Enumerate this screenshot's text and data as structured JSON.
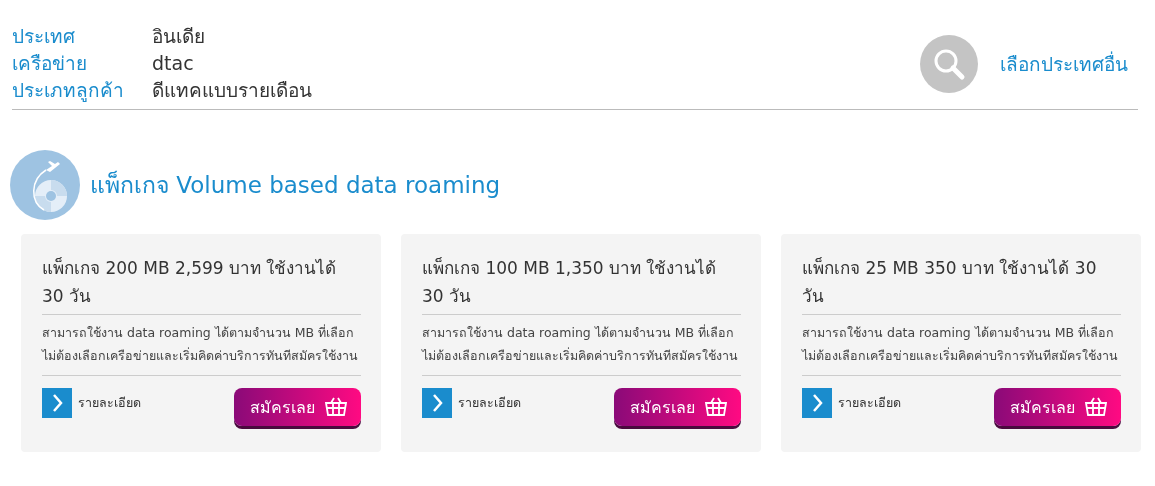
{
  "info": [
    {
      "label": "ประเทศ",
      "value": "อินเดีย"
    },
    {
      "label": "เครือข่าย",
      "value": "dtac"
    },
    {
      "label": "ประเภทลูกค้า",
      "value": "ดีแทคแบบรายเดือน"
    }
  ],
  "change_country": "เลือกประเทศอื่น",
  "section_title": "แพ็กเกจ Volume based data roaming",
  "packages": [
    {
      "title": "แพ็กเกจ 200 MB 2,599 บาท ใช้งานได้ 30 วัน",
      "description": "สามารถใช้งาน data roaming ได้ตามจำนวน MB ที่เลือก ไม่ต้องเลือกเครือข่ายและเริ่มคิดค่าบริการทันทีสมัครใช้งาน",
      "details": "รายละเอียด",
      "subscribe": "สมัครเลย"
    },
    {
      "title": "แพ็กเกจ 100 MB 1,350 บาท ใช้งานได้ 30 วัน",
      "description": "สามารถใช้งาน data roaming ได้ตามจำนวน MB ที่เลือก ไม่ต้องเลือกเครือข่ายและเริ่มคิดค่าบริการทันทีสมัครใช้งาน",
      "details": "รายละเอียด",
      "subscribe": "สมัครเลย"
    },
    {
      "title": "แพ็กเกจ 25 MB 350 บาท ใช้งานได้ 30 วัน",
      "description": "สามารถใช้งาน data roaming ได้ตามจำนวน MB ที่เลือก ไม่ต้องเลือกเครือข่ายและเริ่มคิดค่าบริการทันทีสมัครใช้งาน",
      "details": "รายละเอียด",
      "subscribe": "สมัครเลย"
    }
  ]
}
